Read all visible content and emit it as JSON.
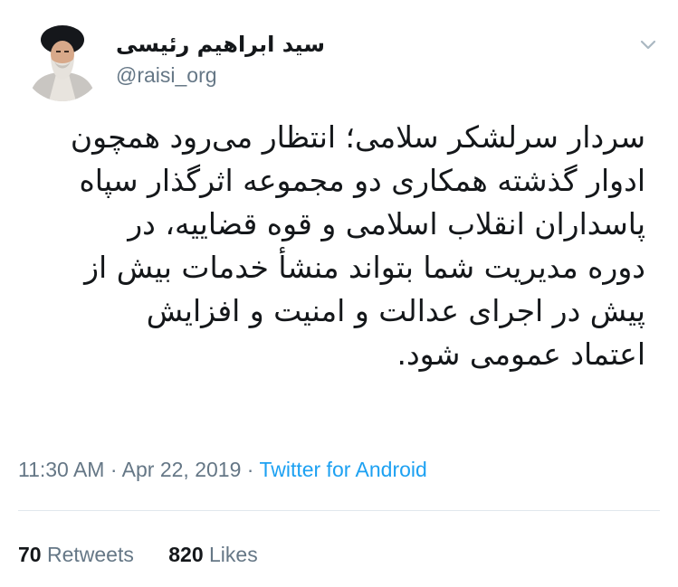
{
  "author": {
    "display_name": "سید ابراهیم رئیسی",
    "handle": "@raisi_org",
    "avatar_icon": "profile-avatar"
  },
  "menu_icon": "chevron-down-icon",
  "tweet": {
    "lines": [
      "سردار سرلشکر سلامی؛ انتظار می‌رود همچون",
      "ادوار گذشته همکاری دو مجموعه اثرگذار سپاه",
      "پاسداران انقلاب اسلامی و قوه قضاییه، در",
      "دوره مدیریت شما بتواند منشأ خدمات بیش از",
      "پیش در اجرای عدالت و امنیت و افزایش",
      "اعتماد عمومی شود."
    ]
  },
  "meta": {
    "time": "11:30 AM",
    "separator": "·",
    "date": "Apr 22, 2019",
    "source": "Twitter for Android"
  },
  "stats": {
    "retweets_count": "70",
    "retweets_label": "Retweets",
    "likes_count": "820",
    "likes_label": "Likes"
  },
  "colors": {
    "text": "#14171a",
    "secondary": "#657786",
    "link": "#1da1f2",
    "divider": "#e1e8ed"
  }
}
